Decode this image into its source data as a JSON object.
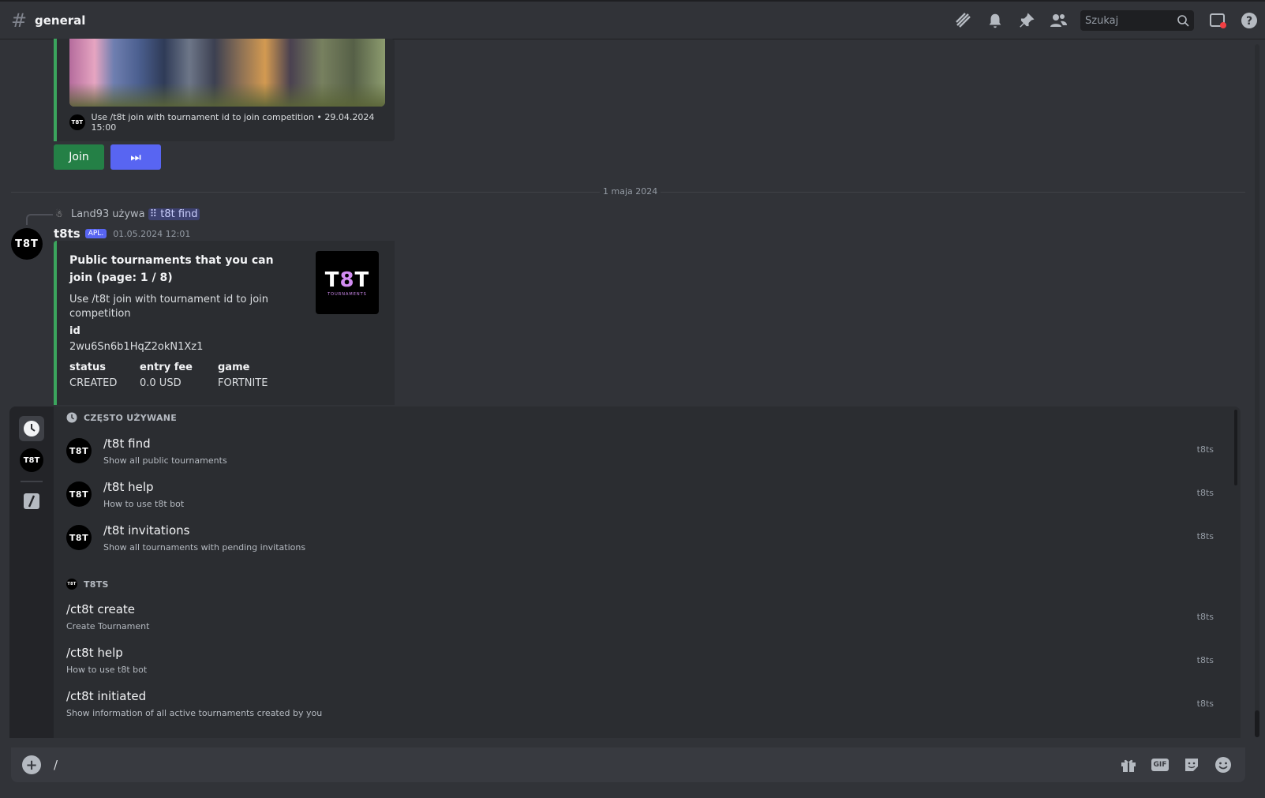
{
  "channel": {
    "hash": "#",
    "name": "general"
  },
  "header": {
    "icons": [
      "threads-icon",
      "bell-icon",
      "pin-icon",
      "members-icon",
      "inbox-icon",
      "help-icon"
    ],
    "search_placeholder": "Szukaj"
  },
  "prev_embed": {
    "footer_avatar": "T8T",
    "footer_text": "Use /t8t join with tournament id to join competition • 29.04.2024 15:00",
    "buttons": {
      "join": "Join",
      "skip": "⏭"
    }
  },
  "date_divider": "1 maja 2024",
  "message": {
    "reply": {
      "user": "Land93",
      "verb": "używa",
      "command": "t8t find"
    },
    "avatar": "T8T",
    "author": "t8ts",
    "badge": "APL.",
    "timestamp": "01.05.2024 12:01",
    "embed": {
      "title": "Public tournaments that you can join (page: 1 / 8)",
      "description": "Use /t8t join with tournament id to join competition",
      "thumbnail": {
        "text_t1": "T",
        "text_8": "8",
        "text_t2": "T",
        "sub": "TOURNAMENTS"
      },
      "fields": {
        "id_name": "id",
        "id_value": "2wu6Sn6b1HqZ2okN1Xz1",
        "status_name": "status",
        "status_value": "CREATED",
        "fee_name": "entry fee",
        "fee_value": "0.0 USD",
        "game_name": "game",
        "game_value": "FORTNITE"
      },
      "accent_color": "#3ba55d"
    }
  },
  "autocomplete": {
    "section_recent": "CZĘSTO UŻYWANE",
    "section_app": "T8TS",
    "recent": [
      {
        "cmd": "/t8t find",
        "desc": "Show all public tournaments",
        "app": "t8ts",
        "avatar": "T8T"
      },
      {
        "cmd": "/t8t help",
        "desc": "How to use t8t bot",
        "app": "t8ts",
        "avatar": "T8T"
      },
      {
        "cmd": "/t8t invitations",
        "desc": "Show all tournaments with pending invitations",
        "app": "t8ts",
        "avatar": "T8T"
      }
    ],
    "app_cmds": [
      {
        "cmd": "/ct8t create",
        "desc": "Create Tournament",
        "app": "t8ts"
      },
      {
        "cmd": "/ct8t help",
        "desc": "How to use t8t bot",
        "app": "t8ts"
      },
      {
        "cmd": "/ct8t initiated",
        "desc": "Show information of all active tournaments created by you",
        "app": "t8ts"
      }
    ],
    "rail": [
      "clock-icon",
      "t8ts-app-icon",
      "slash-command-icon"
    ]
  },
  "composer": {
    "value": "/",
    "icons": [
      "gift-icon",
      "gif-icon",
      "sticker-icon",
      "emoji-icon"
    ],
    "gif_label": "GIF"
  },
  "colors": {
    "accent": "#5865f2",
    "success": "#248046",
    "background": "#313338"
  }
}
